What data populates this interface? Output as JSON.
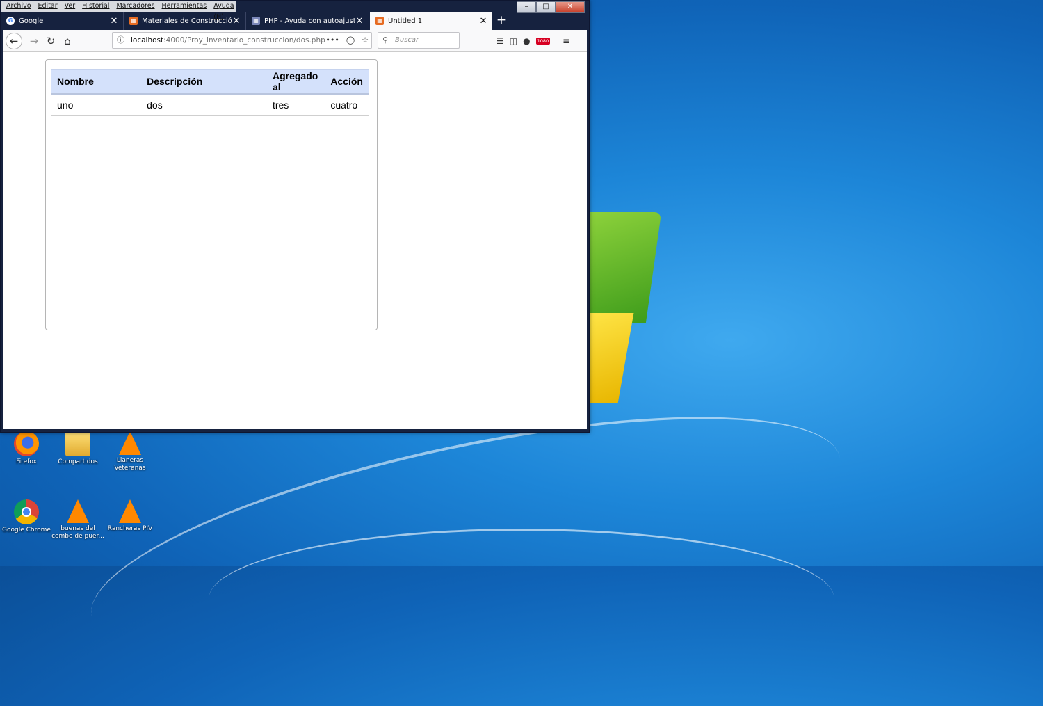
{
  "browser": {
    "menu": [
      "Archivo",
      "Editar",
      "Ver",
      "Historial",
      "Marcadores",
      "Herramientas",
      "Ayuda (H)"
    ],
    "tabs": [
      {
        "title": "Google",
        "favicon": "google-icon",
        "active": false
      },
      {
        "title": "Materiales de Construcción",
        "favicon": "page-icon",
        "active": false
      },
      {
        "title": "PHP - Ayuda con autoajustar n",
        "favicon": "page-icon",
        "active": false
      },
      {
        "title": "Untitled 1",
        "favicon": "page-icon",
        "active": true
      }
    ],
    "url_host": "localhost",
    "url_path": ":4000/Proy_inventario_construccion/dos.php",
    "search_placeholder": "Buscar",
    "badge": "1080"
  },
  "page": {
    "table": {
      "headers": [
        "Nombre",
        "Descripción",
        "Agregado al",
        "Acción"
      ],
      "rows": [
        [
          "uno",
          "dos",
          "tres",
          "cuatro"
        ]
      ]
    }
  },
  "desktop": {
    "icons": [
      {
        "label": "Firefox",
        "icon": "firefox-icon"
      },
      {
        "label": "Compartidos",
        "icon": "folder-icon"
      },
      {
        "label": "Llaneras Veteranas",
        "icon": "vlc-icon"
      },
      {
        "label": "Google Chrome",
        "icon": "chrome-icon"
      },
      {
        "label": "buenas del combo de puer...",
        "icon": "vlc-icon"
      },
      {
        "label": "Rancheras PIV",
        "icon": "vlc-icon"
      }
    ]
  }
}
